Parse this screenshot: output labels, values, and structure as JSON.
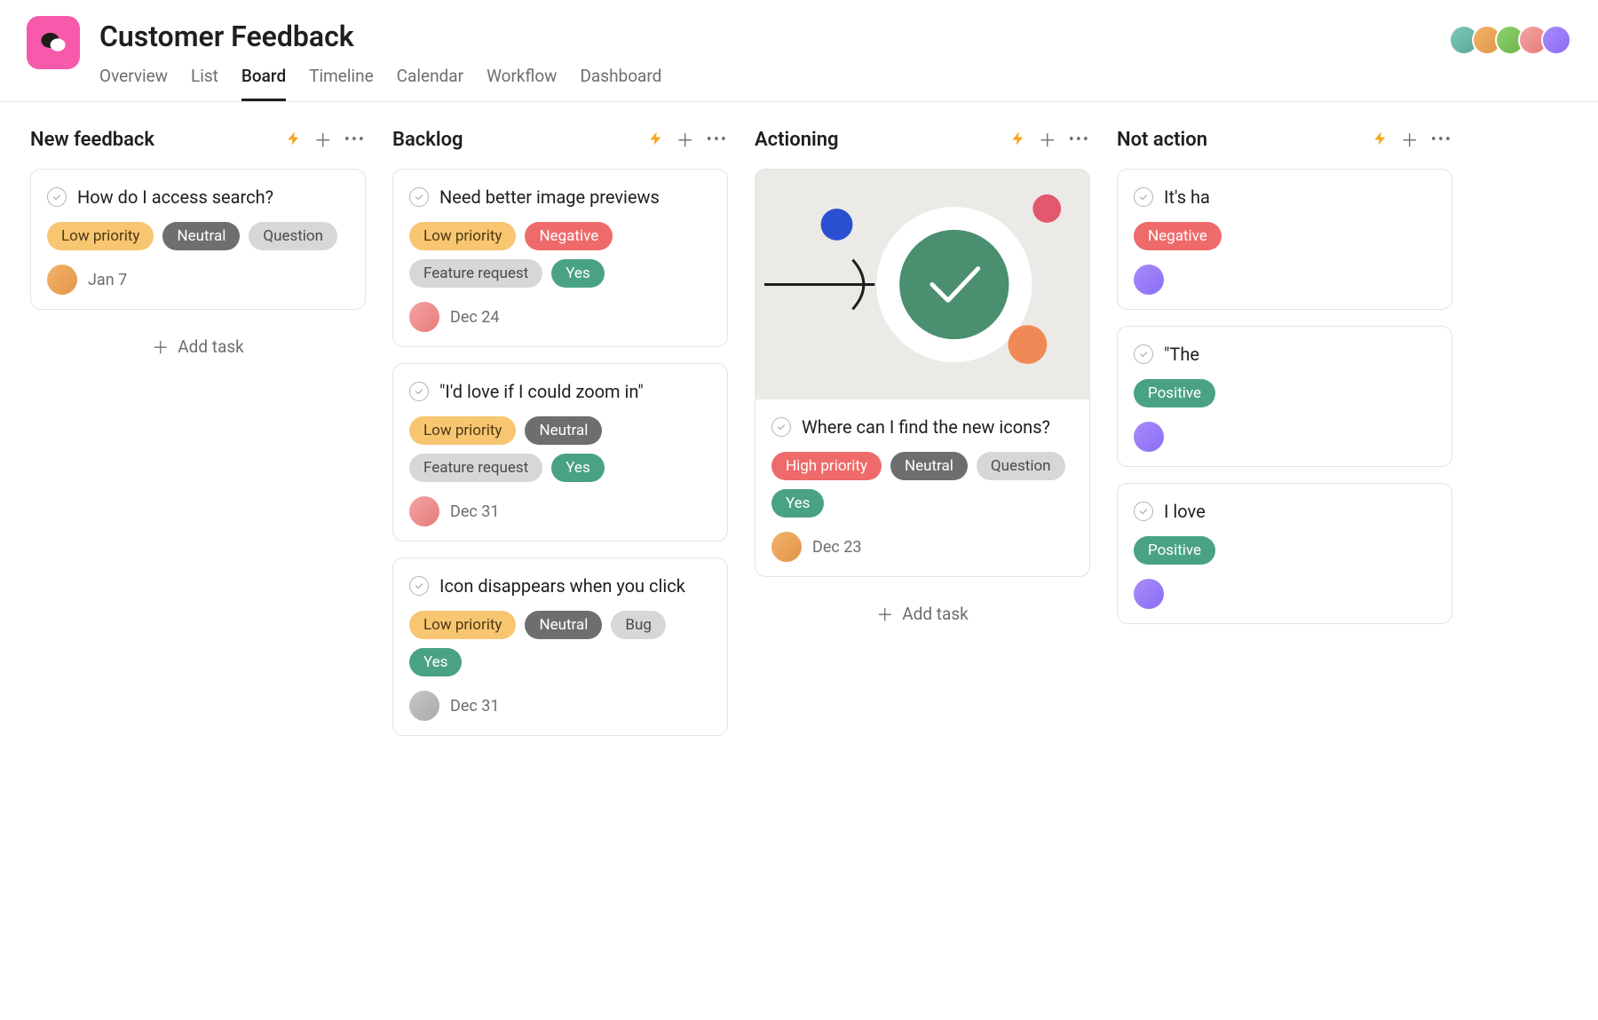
{
  "project": {
    "title": "Customer Feedback"
  },
  "tabs": [
    {
      "label": "Overview",
      "active": false
    },
    {
      "label": "List",
      "active": false
    },
    {
      "label": "Board",
      "active": true
    },
    {
      "label": "Timeline",
      "active": false
    },
    {
      "label": "Calendar",
      "active": false
    },
    {
      "label": "Workflow",
      "active": false
    },
    {
      "label": "Dashboard",
      "active": false
    }
  ],
  "members": [
    "av-a",
    "av-b",
    "av-c",
    "av-e",
    "av-d"
  ],
  "add_task_label": "Add task",
  "tag_colors": {
    "Low priority": "t-low",
    "High priority": "t-high",
    "Neutral": "t-neutral",
    "Question": "t-question",
    "Feature request": "t-feature",
    "Negative": "t-negative",
    "Yes": "t-yes",
    "Bug": "t-bug",
    "Positive": "t-positive"
  },
  "columns": [
    {
      "title": "New feedback",
      "show_add": true,
      "cards": [
        {
          "title": "How do I access search?",
          "tags": [
            "Low priority",
            "Neutral",
            "Question"
          ],
          "tag_variants": {
            "Neutral": "t-neutral"
          },
          "assignee": "av-b",
          "date": "Jan 7"
        }
      ]
    },
    {
      "title": "Backlog",
      "show_add": false,
      "cards": [
        {
          "title": "Need better image previews",
          "tags": [
            "Low priority",
            "Negative",
            "Feature request",
            "Yes"
          ],
          "assignee": "av-e",
          "date": "Dec 24"
        },
        {
          "title": "\"I'd love if I could zoom in\"",
          "tags": [
            "Low priority",
            "Neutral",
            "Feature request",
            "Yes"
          ],
          "tag_variants": {
            "Neutral": "t-neutral"
          },
          "assignee": "av-e",
          "date": "Dec 31"
        },
        {
          "title": "Icon disappears when you click",
          "tags": [
            "Low priority",
            "Neutral",
            "Bug",
            "Yes"
          ],
          "tag_variants": {
            "Neutral": "t-neutral"
          },
          "assignee": "av-f",
          "date": "Dec 31"
        }
      ]
    },
    {
      "title": "Actioning",
      "show_add": true,
      "cards": [
        {
          "cover": true,
          "title": "Where can I find the new icons?",
          "tags": [
            "High priority",
            "Neutral",
            "Question",
            "Yes"
          ],
          "tag_variants": {
            "Neutral": "t-neutral"
          },
          "assignee": "av-b",
          "date": "Dec 23"
        }
      ]
    },
    {
      "title": "Not action",
      "show_add": false,
      "cards": [
        {
          "title": "It's ha",
          "tags": [
            "Negative"
          ],
          "assignee": "av-d",
          "date": ""
        },
        {
          "title": "\"The",
          "tags": [
            "Positive"
          ],
          "assignee": "av-d",
          "date": ""
        },
        {
          "title": "I love",
          "tags": [
            "Positive"
          ],
          "assignee": "av-d",
          "date": ""
        }
      ]
    }
  ]
}
